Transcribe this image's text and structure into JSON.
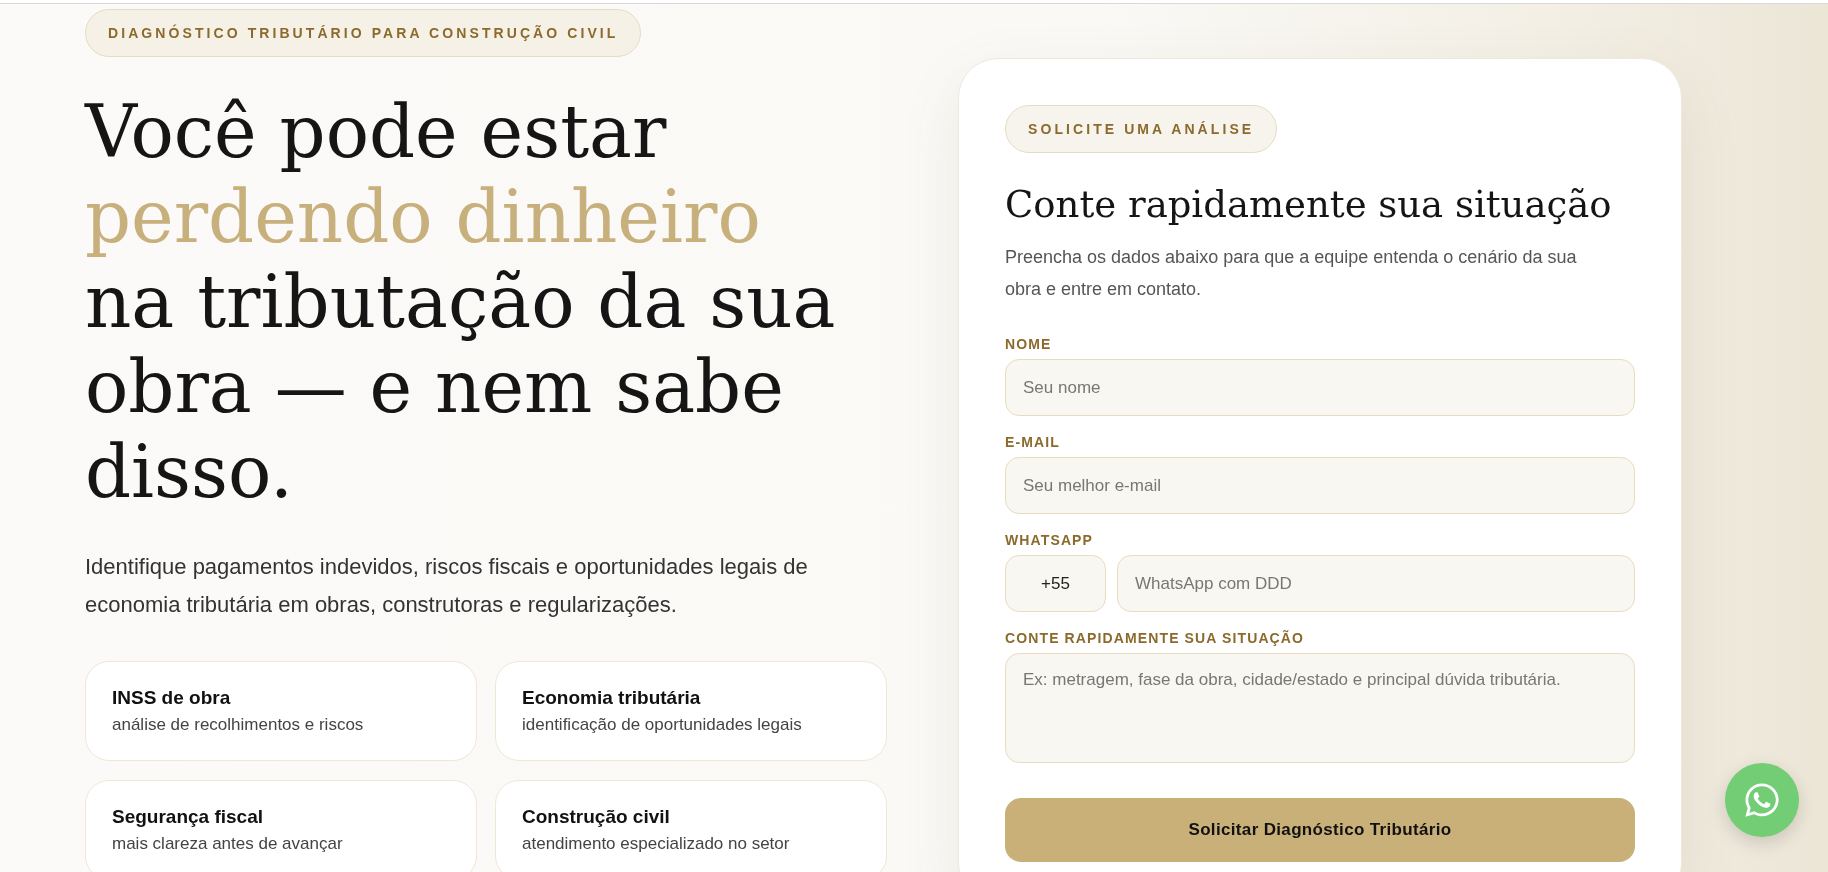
{
  "hero": {
    "badge": "DIAGNÓSTICO TRIBUTÁRIO PARA CONSTRUÇÃO CIVIL",
    "heading": {
      "lead": "Você pode estar",
      "highlight": "perdendo dinheiro",
      "rest": "na tributação da sua obra — e nem sabe disso."
    },
    "description": "Identifique pagamentos indevidos, riscos fiscais e oportunidades legais de economia tributária em obras, construtoras e regularizações.",
    "features": [
      {
        "title": "INSS de obra",
        "subtitle": "análise de recolhimentos e riscos"
      },
      {
        "title": "Economia tributária",
        "subtitle": "identificação de oportunidades legais"
      },
      {
        "title": "Segurança fiscal",
        "subtitle": "mais clareza antes de avançar"
      },
      {
        "title": "Construção civil",
        "subtitle": "atendimento especializado no setor"
      }
    ]
  },
  "form": {
    "badge": "SOLICITE UMA ANÁLISE",
    "title": "Conte rapidamente sua situação",
    "description": "Preencha os dados abaixo para que a equipe entenda o cenário da sua obra e entre em contato.",
    "fields": [
      {
        "kind": "text",
        "label": "NOME",
        "placeholder": "Seu nome"
      },
      {
        "kind": "text",
        "label": "E-MAIL",
        "placeholder": "Seu melhor e-mail"
      },
      {
        "kind": "phone",
        "label": "WHATSAPP",
        "country_code": "+55",
        "placeholder": "WhatsApp com DDD"
      },
      {
        "kind": "textarea",
        "label": "CONTE RAPIDAMENTE SUA SITUAÇÃO",
        "placeholder": "Ex: metragem, fase da obra, cidade/estado e principal dúvida tributária."
      }
    ],
    "submit": "Solicitar Diagnóstico Tributário"
  }
}
